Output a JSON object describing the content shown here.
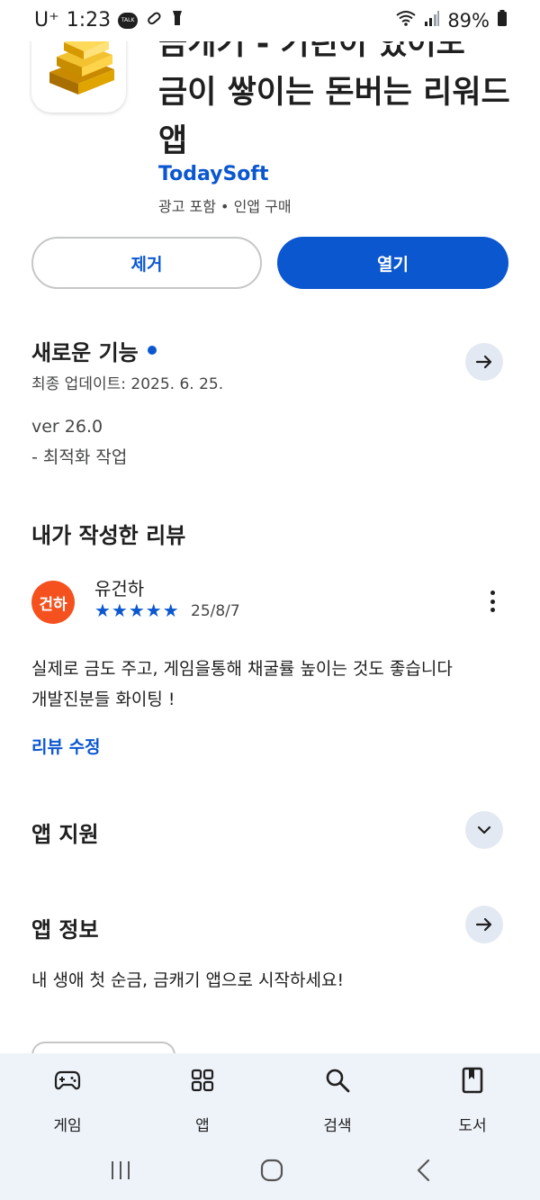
{
  "status_bar": {
    "carrier": "U⁺",
    "time": "1:23",
    "talk_badge": "TALK",
    "battery": "89%"
  },
  "app": {
    "title": "금캐기 - 기린이 있어도 금이 쌓이는 돈버는 리워드 앱",
    "title_visible_lines": [
      "금캐기 - 기린이 있어도",
      "금이 쌓이는 돈버는 리워드",
      "앱"
    ],
    "developer": "TodaySoft",
    "meta": "광고 포함 • 인앱 구매"
  },
  "actions": {
    "remove_label": "제거",
    "open_label": "열기"
  },
  "whats_new": {
    "title": "새로운 기능",
    "updated": "최종 업데이트: 2025. 6. 25.",
    "version": "ver 26.0",
    "note": "- 최적화 작업"
  },
  "my_review": {
    "title": "내가 작성한 리뷰",
    "avatar_text": "건하",
    "reviewer": "유건하",
    "stars": "★★★★★",
    "rating": 5,
    "date": "25/8/7",
    "text_line1": "실제로 금도 주고, 게임을통해 채굴률 높이는 것도 좋습니다",
    "text_line2": "개발진분들 화이팅 !",
    "edit_label": "리뷰 수정"
  },
  "app_support": {
    "title": "앱 지원"
  },
  "app_info": {
    "title": "앱 정보",
    "description": "내 생애 첫 순금, 금캐기 앱으로 시작하세요!"
  },
  "bottom_nav": [
    {
      "label": "게임",
      "icon": "gamepad-icon"
    },
    {
      "label": "앱",
      "icon": "apps-grid-icon"
    },
    {
      "label": "검색",
      "icon": "search-icon"
    },
    {
      "label": "도서",
      "icon": "book-icon"
    }
  ],
  "colors": {
    "accent": "#0b57d0",
    "avatar": "#f4511e",
    "nav_bg": "#eef2f9",
    "circle_btn": "#e3e9f2"
  }
}
